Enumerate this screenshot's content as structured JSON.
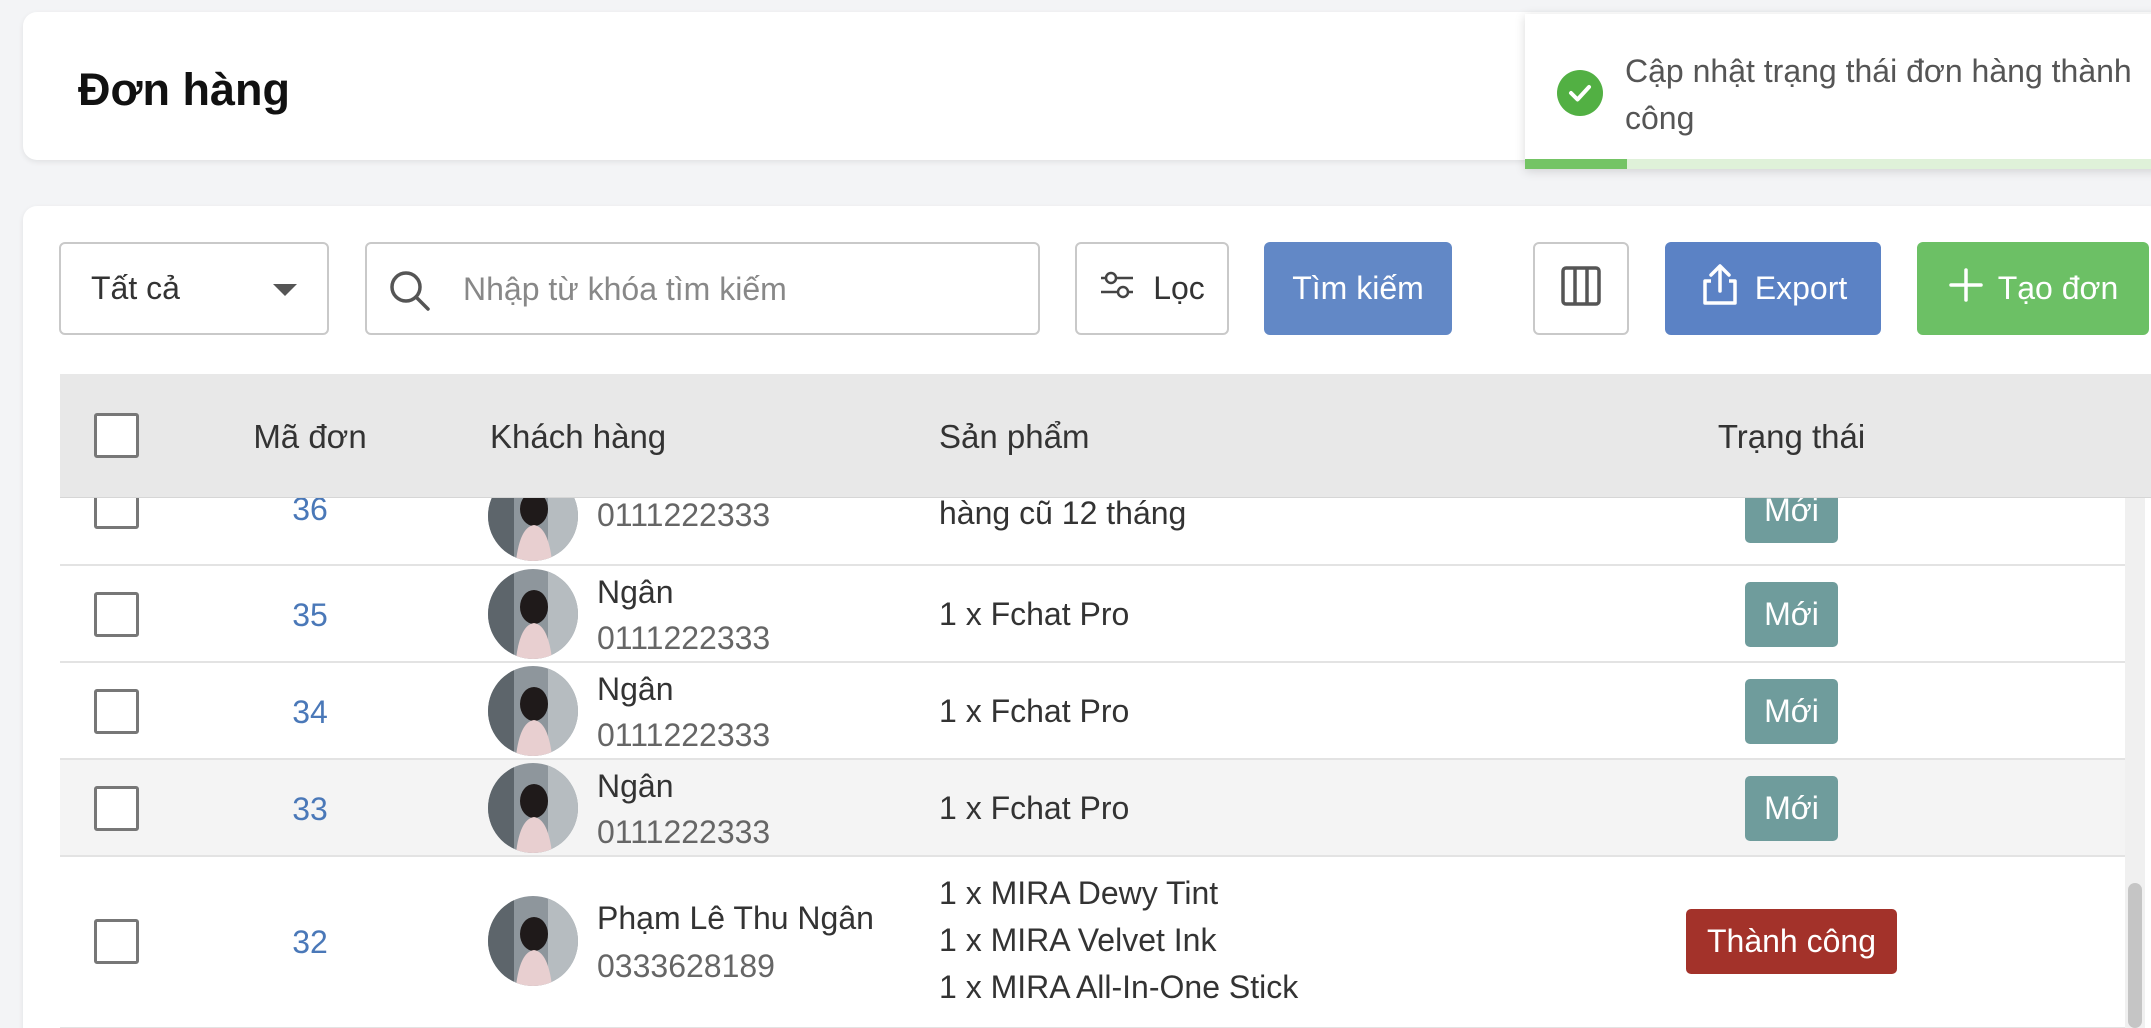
{
  "page": {
    "title": "Đơn hàng"
  },
  "toast": {
    "message": "Cập nhật trạng thái đơn hàng thành công",
    "icon": "check-circle-icon",
    "progress": 0.16,
    "color": "#52b043"
  },
  "toolbar": {
    "status_select": "Tất cả",
    "search_placeholder": "Nhập từ khóa tìm kiếm",
    "filter_label": "Lọc",
    "search_button": "Tìm kiếm",
    "export_label": "Export",
    "create_label": "Tạo đơn"
  },
  "table": {
    "headers": {
      "order_id": "Mã đơn",
      "customer": "Khách hàng",
      "products": "Sản phẩm",
      "status": "Trạng thái"
    },
    "rows": [
      {
        "id": "36",
        "phone": "0111222333",
        "product_line": "hàng cũ 12 tháng",
        "status": "Mới"
      },
      {
        "id": "35",
        "name": "Ngân",
        "phone": "0111222333",
        "products": [
          "1 x Fchat Pro"
        ],
        "status": "Mới"
      },
      {
        "id": "34",
        "name": "Ngân",
        "phone": "0111222333",
        "products": [
          "1 x Fchat Pro"
        ],
        "status": "Mới"
      },
      {
        "id": "33",
        "name": "Ngân",
        "phone": "0111222333",
        "products": [
          "1 x Fchat Pro"
        ],
        "status": "Mới"
      },
      {
        "id": "32",
        "name": "Phạm Lê Thu Ngân",
        "phone": "0333628189",
        "products": [
          "1 x MIRA Dewy Tint",
          "1 x MIRA Velvet Ink",
          "1 x MIRA All-In-One Stick"
        ],
        "status": "Thành công"
      }
    ]
  },
  "colors": {
    "new_badge": "#6f9c9c",
    "success_badge": "#a3322a",
    "search_button": "#6288c6",
    "export_button": "#5b82c5",
    "create_button": "#6cc065",
    "order_link": "#4a78b8"
  }
}
